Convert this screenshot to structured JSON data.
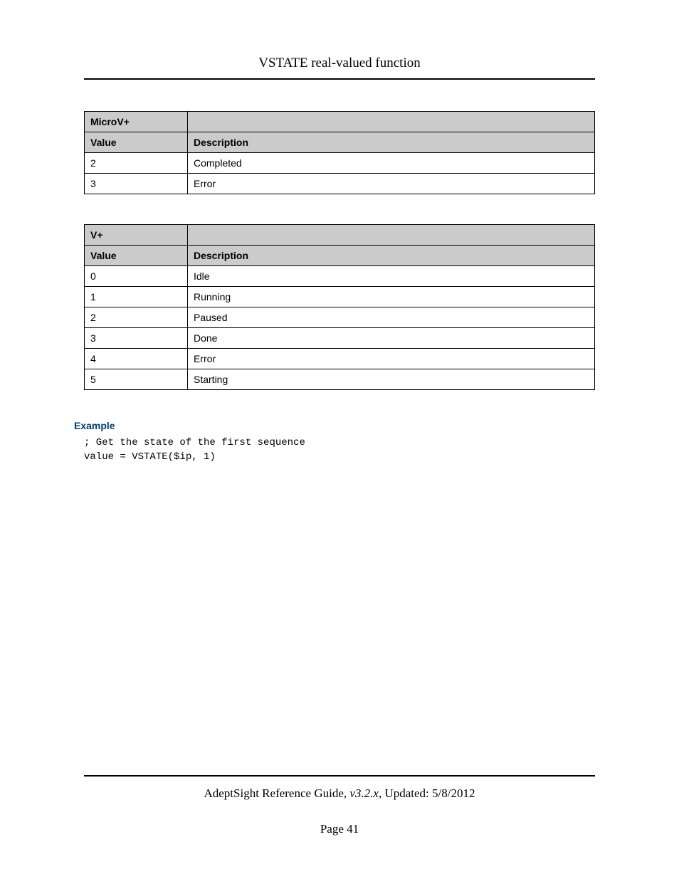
{
  "header": {
    "title": "VSTATE real-valued function"
  },
  "table_microv": {
    "title": "MicroV+",
    "col1": "Value",
    "col2": "Description",
    "rows": [
      {
        "value": "2",
        "desc": "Completed"
      },
      {
        "value": "3",
        "desc": "Error"
      }
    ]
  },
  "table_vplus": {
    "title": "V+",
    "col1": "Value",
    "col2": "Description",
    "rows": [
      {
        "value": "0",
        "desc": "Idle"
      },
      {
        "value": "1",
        "desc": "Running"
      },
      {
        "value": "2",
        "desc": "Paused"
      },
      {
        "value": "3",
        "desc": "Done"
      },
      {
        "value": "4",
        "desc": "Error"
      },
      {
        "value": "5",
        "desc": "Starting"
      }
    ]
  },
  "example": {
    "heading": "Example",
    "code": "; Get the state of the first sequence\nvalue = VSTATE($ip, 1)"
  },
  "footer": {
    "doc_title": "AdeptSight Reference Guide",
    "version": ", v3.2.x",
    "updated_label": ", Updated: ",
    "updated_date": "5/8/2012",
    "page_label": "Page ",
    "page_number": "41"
  }
}
